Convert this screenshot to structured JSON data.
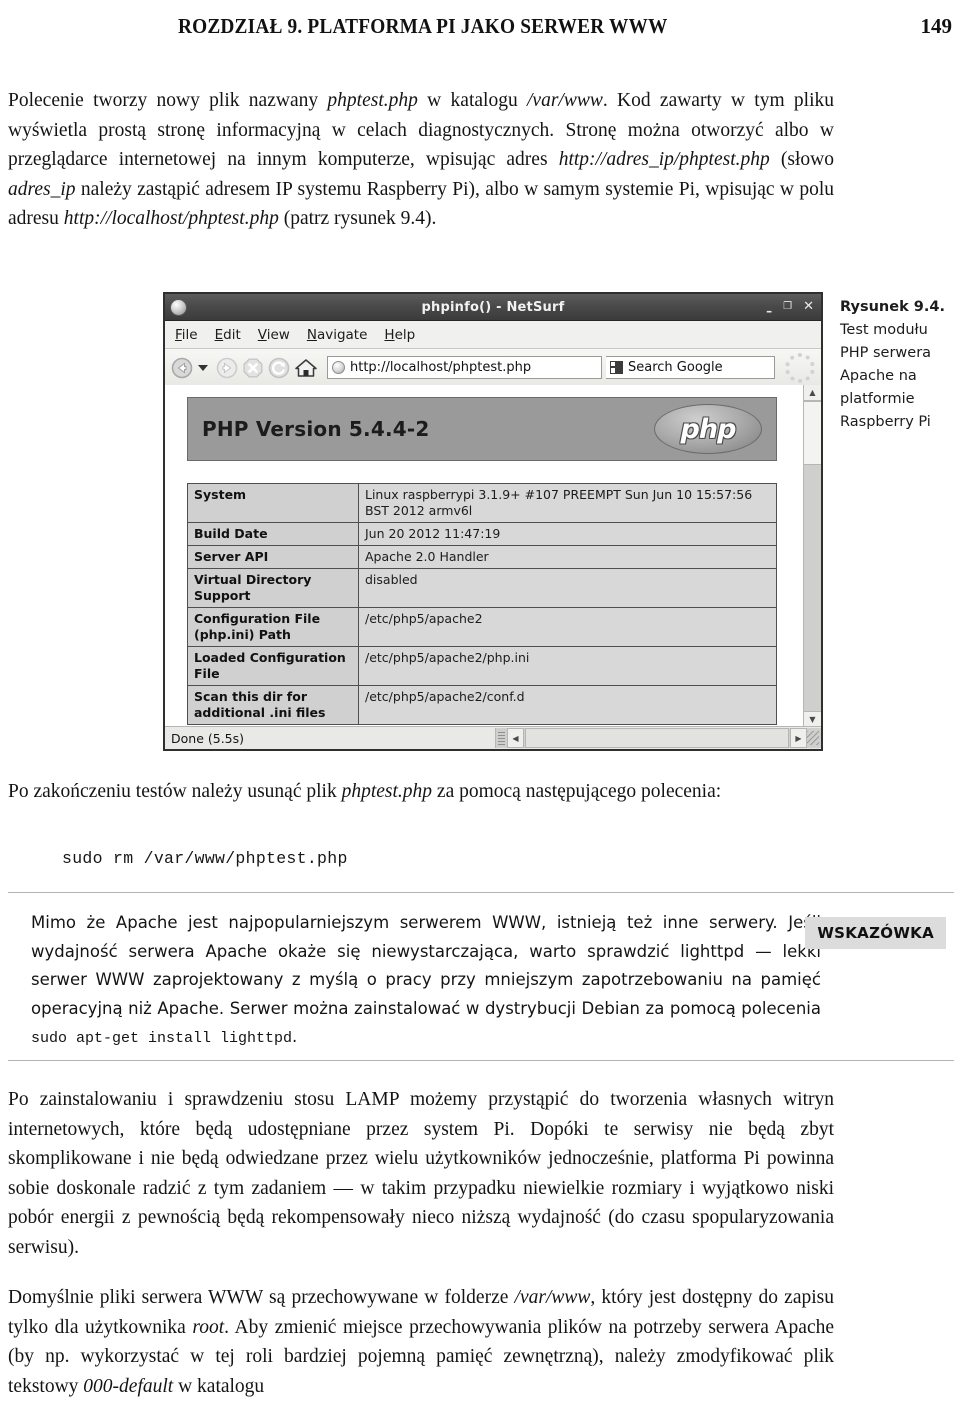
{
  "running_head": {
    "chapter_title": "ROZDZIAŁ 9. PLATFORMA PI JAKO SERWER WWW",
    "page_number": "149"
  },
  "paragraphs": {
    "intro_1": "Polecenie tworzy nowy plik nazwany ",
    "intro_i1": "phptest.php",
    "intro_2": " w katalogu ",
    "intro_i2": "/var/www",
    "intro_3": ". Kod zawarty w tym pliku wyświetla prostą stronę informacyjną w celach diagnostycznych. Stronę można otworzyć albo w przeglądarce internetowej na innym komputerze, wpisując adres ",
    "intro_i3": "http://adres_ip/phptest.php",
    "intro_4": " (słowo ",
    "intro_i4": "adres_ip",
    "intro_5": " należy zastąpić adresem IP systemu Raspberry Pi), albo w samym systemie Pi, wpisując w polu adresu ",
    "intro_i5": "http://localhost/phptest.php",
    "intro_6": " (patrz rysunek 9.4).",
    "after_fig_1": "Po zakończeniu testów należy usunąć plik ",
    "after_fig_i1": "phptest.php",
    "after_fig_2": " za pomocą następującego polecenia:",
    "lamp": "Po zainstalowaniu i sprawdzeniu stosu LAMP możemy przystąpić do tworzenia własnych witryn internetowych, które będą udostępniane przez system Pi. Dopóki te serwisy nie będą zbyt skomplikowane i nie będą odwiedzane przez wielu użytkowników jednocześnie, platforma Pi powinna sobie doskonale radzić z tym zadaniem — w takim przypadku niewielkie rozmiary i wyjątkowo niski pobór energii z pewnością będą rekompensowały nieco niższą wydajność (do czasu spopularyzowania serwisu).",
    "default_1": "Domyślnie pliki serwera WWW są przechowywane w folderze ",
    "default_i1": "/var/www",
    "default_2": ", który jest dostępny do zapisu tylko dla użytkownika ",
    "default_i2": "root",
    "default_3": ". Aby zmienić miejsce przechowywania plików na potrzeby serwera Apache (by np. wykorzystać w tej roli bardziej pojemną pamięć zewnętrzną), należy zmodyfikować plik tekstowy ",
    "default_i3": "000-default",
    "default_4": " w katalogu"
  },
  "code": {
    "remove_command": "sudo rm /var/www/phptest.php"
  },
  "figure": {
    "caption_label": "Rysunek 9.4.",
    "caption_text": "Test modułu PHP serwera Apache na platformie Raspberry Pi",
    "browser": {
      "window_title": "phpinfo() - NetSurf",
      "window_buttons": {
        "minimize": "–",
        "maximize": "❐",
        "close": "✕"
      },
      "menu": [
        {
          "prefix": "F",
          "rest": "ile"
        },
        {
          "prefix": "E",
          "rest": "dit"
        },
        {
          "prefix": "V",
          "rest": "iew"
        },
        {
          "prefix": "N",
          "rest": "avigate"
        },
        {
          "prefix": "H",
          "rest": "elp"
        }
      ],
      "toolbar": {
        "url_value": "http://localhost/phptest.php",
        "search_value": "Search Google"
      },
      "statusbar": {
        "status": "Done (5.5s)"
      },
      "page": {
        "php_version_heading": "PHP Version 5.4.4-2",
        "php_logo_text": "php",
        "table_rows": [
          {
            "key": "System",
            "value": "Linux raspberrypi 3.1.9+ #107 PREEMPT Sun Jun 10 15:57:56 BST 2012 armv6l"
          },
          {
            "key": "Build Date",
            "value": "Jun 20 2012 11:47:19"
          },
          {
            "key": "Server API",
            "value": "Apache 2.0 Handler"
          },
          {
            "key": "Virtual Directory Support",
            "value": "disabled"
          },
          {
            "key": "Configuration File (php.ini) Path",
            "value": "/etc/php5/apache2"
          },
          {
            "key": "Loaded Configuration File",
            "value": "/etc/php5/apache2/php.ini"
          },
          {
            "key": "Scan this dir for additional .ini files",
            "value": "/etc/php5/apache2/conf.d"
          }
        ]
      }
    }
  },
  "tip": {
    "badge": "WSKAZÓWKA",
    "text_1": "Mimo że Apache jest najpopularniejszym serwerem WWW, istnieją też inne serwery. Jeśli wydajność serwera Apache okaże się niewystarczająca, warto sprawdzić lighttpd — lekki serwer WWW zaprojektowany z myślą o pracy przy mniejszym zapotrzebowaniu na pamięć operacyjną niż Apache. Serwer można zainstalować w dystrybucji Debian za pomocą polecenia ",
    "text_mono": "sudo apt-get install lighttpd",
    "text_2": "."
  }
}
